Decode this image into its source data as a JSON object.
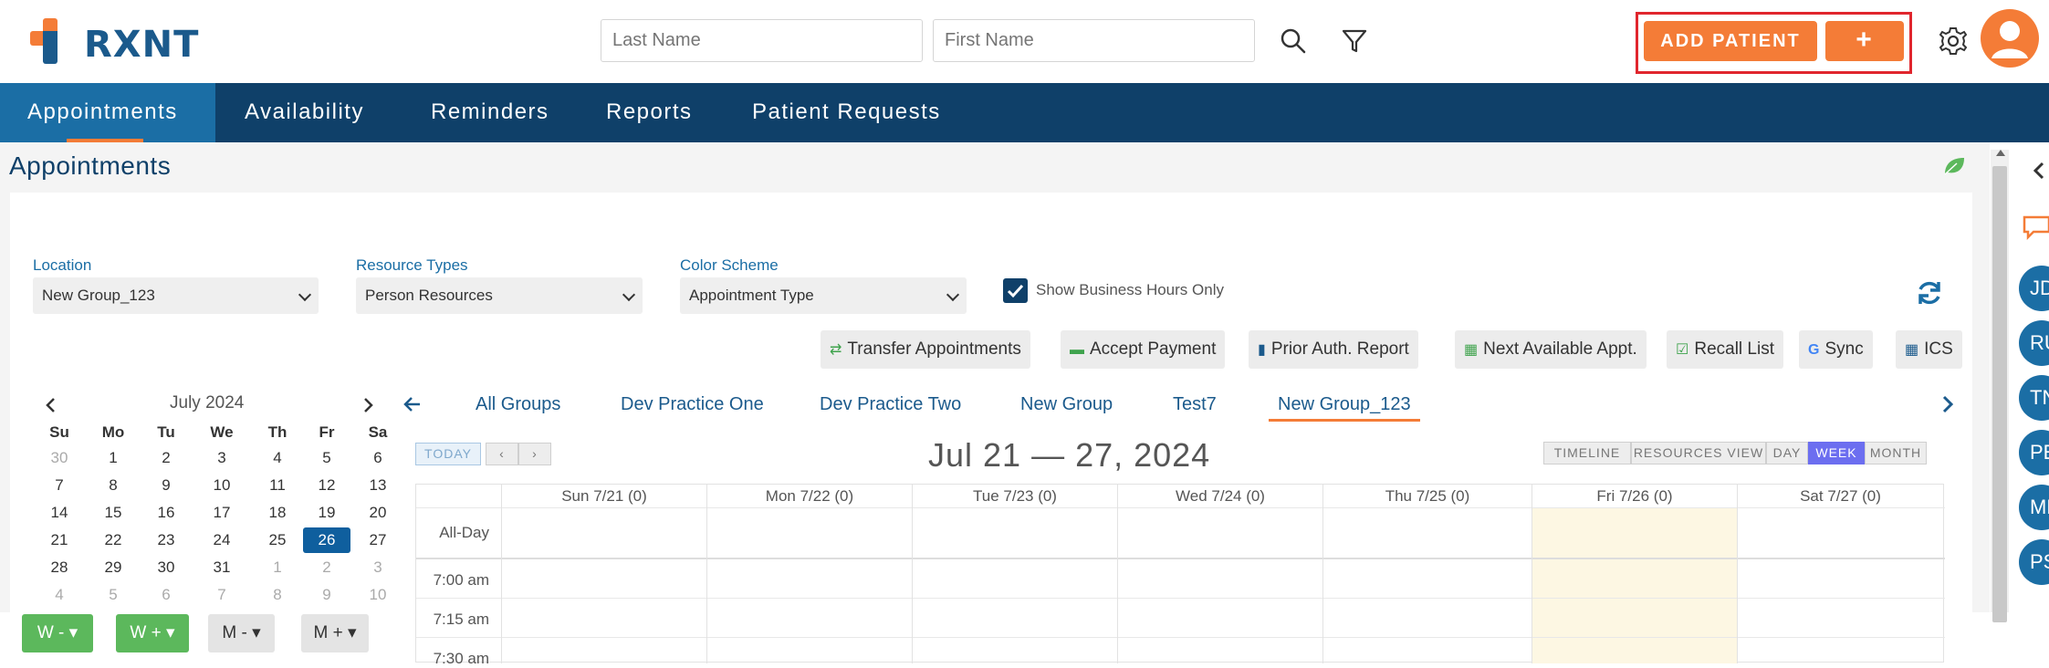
{
  "brand": {
    "name": "RXNT",
    "cross_orange": "#f47c37",
    "cross_blue": "#1b5a8c"
  },
  "header": {
    "last_name_placeholder": "Last Name",
    "first_name_placeholder": "First Name",
    "add_patient_label": "ADD PATIENT",
    "add_plus_label": "+"
  },
  "nav": {
    "items": [
      "Appointments",
      "Availability",
      "Reminders",
      "Reports",
      "Patient Requests"
    ],
    "active": "Appointments"
  },
  "page": {
    "title": "Appointments"
  },
  "filters": {
    "location": {
      "label": "Location",
      "value": "New Group_123"
    },
    "resource_types": {
      "label": "Resource Types",
      "value": "Person Resources"
    },
    "color_scheme": {
      "label": "Color Scheme",
      "value": "Appointment Type"
    },
    "business_hours": {
      "label": "Show Business Hours Only",
      "checked": true
    }
  },
  "toolbar": {
    "transfer": "Transfer Appointments",
    "accept_payment": "Accept Payment",
    "prior_auth": "Prior Auth. Report",
    "next_available": "Next Available Appt.",
    "recall_list": "Recall List",
    "sync": "Sync",
    "ics": "ICS"
  },
  "mini_calendar": {
    "month": "July 2024",
    "dow": [
      "Su",
      "Mo",
      "Tu",
      "We",
      "Th",
      "Fr",
      "Sa"
    ],
    "weeks": [
      [
        "30",
        "1",
        "2",
        "3",
        "4",
        "5",
        "6"
      ],
      [
        "7",
        "8",
        "9",
        "10",
        "11",
        "12",
        "13"
      ],
      [
        "14",
        "15",
        "16",
        "17",
        "18",
        "19",
        "20"
      ],
      [
        "21",
        "22",
        "23",
        "24",
        "25",
        "26",
        "27"
      ],
      [
        "28",
        "29",
        "30",
        "31",
        "1",
        "2",
        "3"
      ],
      [
        "4",
        "5",
        "6",
        "7",
        "8",
        "9",
        "10"
      ]
    ],
    "selected": "26",
    "buttons": [
      "W -",
      "W +",
      "M -",
      "M +"
    ]
  },
  "groups": {
    "tabs": [
      "All Groups",
      "Dev Practice One",
      "Dev Practice Two",
      "New Group",
      "Test7",
      "New Group_123"
    ],
    "active": "New Group_123"
  },
  "calendar": {
    "today_label": "TODAY",
    "date_range": "Jul 21 — 27, 2024",
    "views": [
      "TIMELINE",
      "RESOURCES VIEW",
      "DAY",
      "WEEK",
      "MONTH"
    ],
    "active_view": "WEEK",
    "days": [
      "Sun 7/21 (0)",
      "Mon 7/22 (0)",
      "Tue 7/23 (0)",
      "Wed 7/24 (0)",
      "Thu 7/25 (0)",
      "Fri 7/26 (0)",
      "Sat 7/27 (0)"
    ],
    "all_day_label": "All-Day",
    "times": [
      "7:00 am",
      "7:15 am",
      "7:30 am"
    ]
  },
  "rail": {
    "initials": [
      "JD",
      "RU",
      "TN",
      "PE",
      "ML",
      "PS"
    ]
  },
  "colors": {
    "nav_bg": "#0f4069",
    "nav_active": "#1b6ea5",
    "accent": "#f47c37",
    "highlight_day": "#fdf7e3",
    "active_view": "#6c6ef0"
  }
}
